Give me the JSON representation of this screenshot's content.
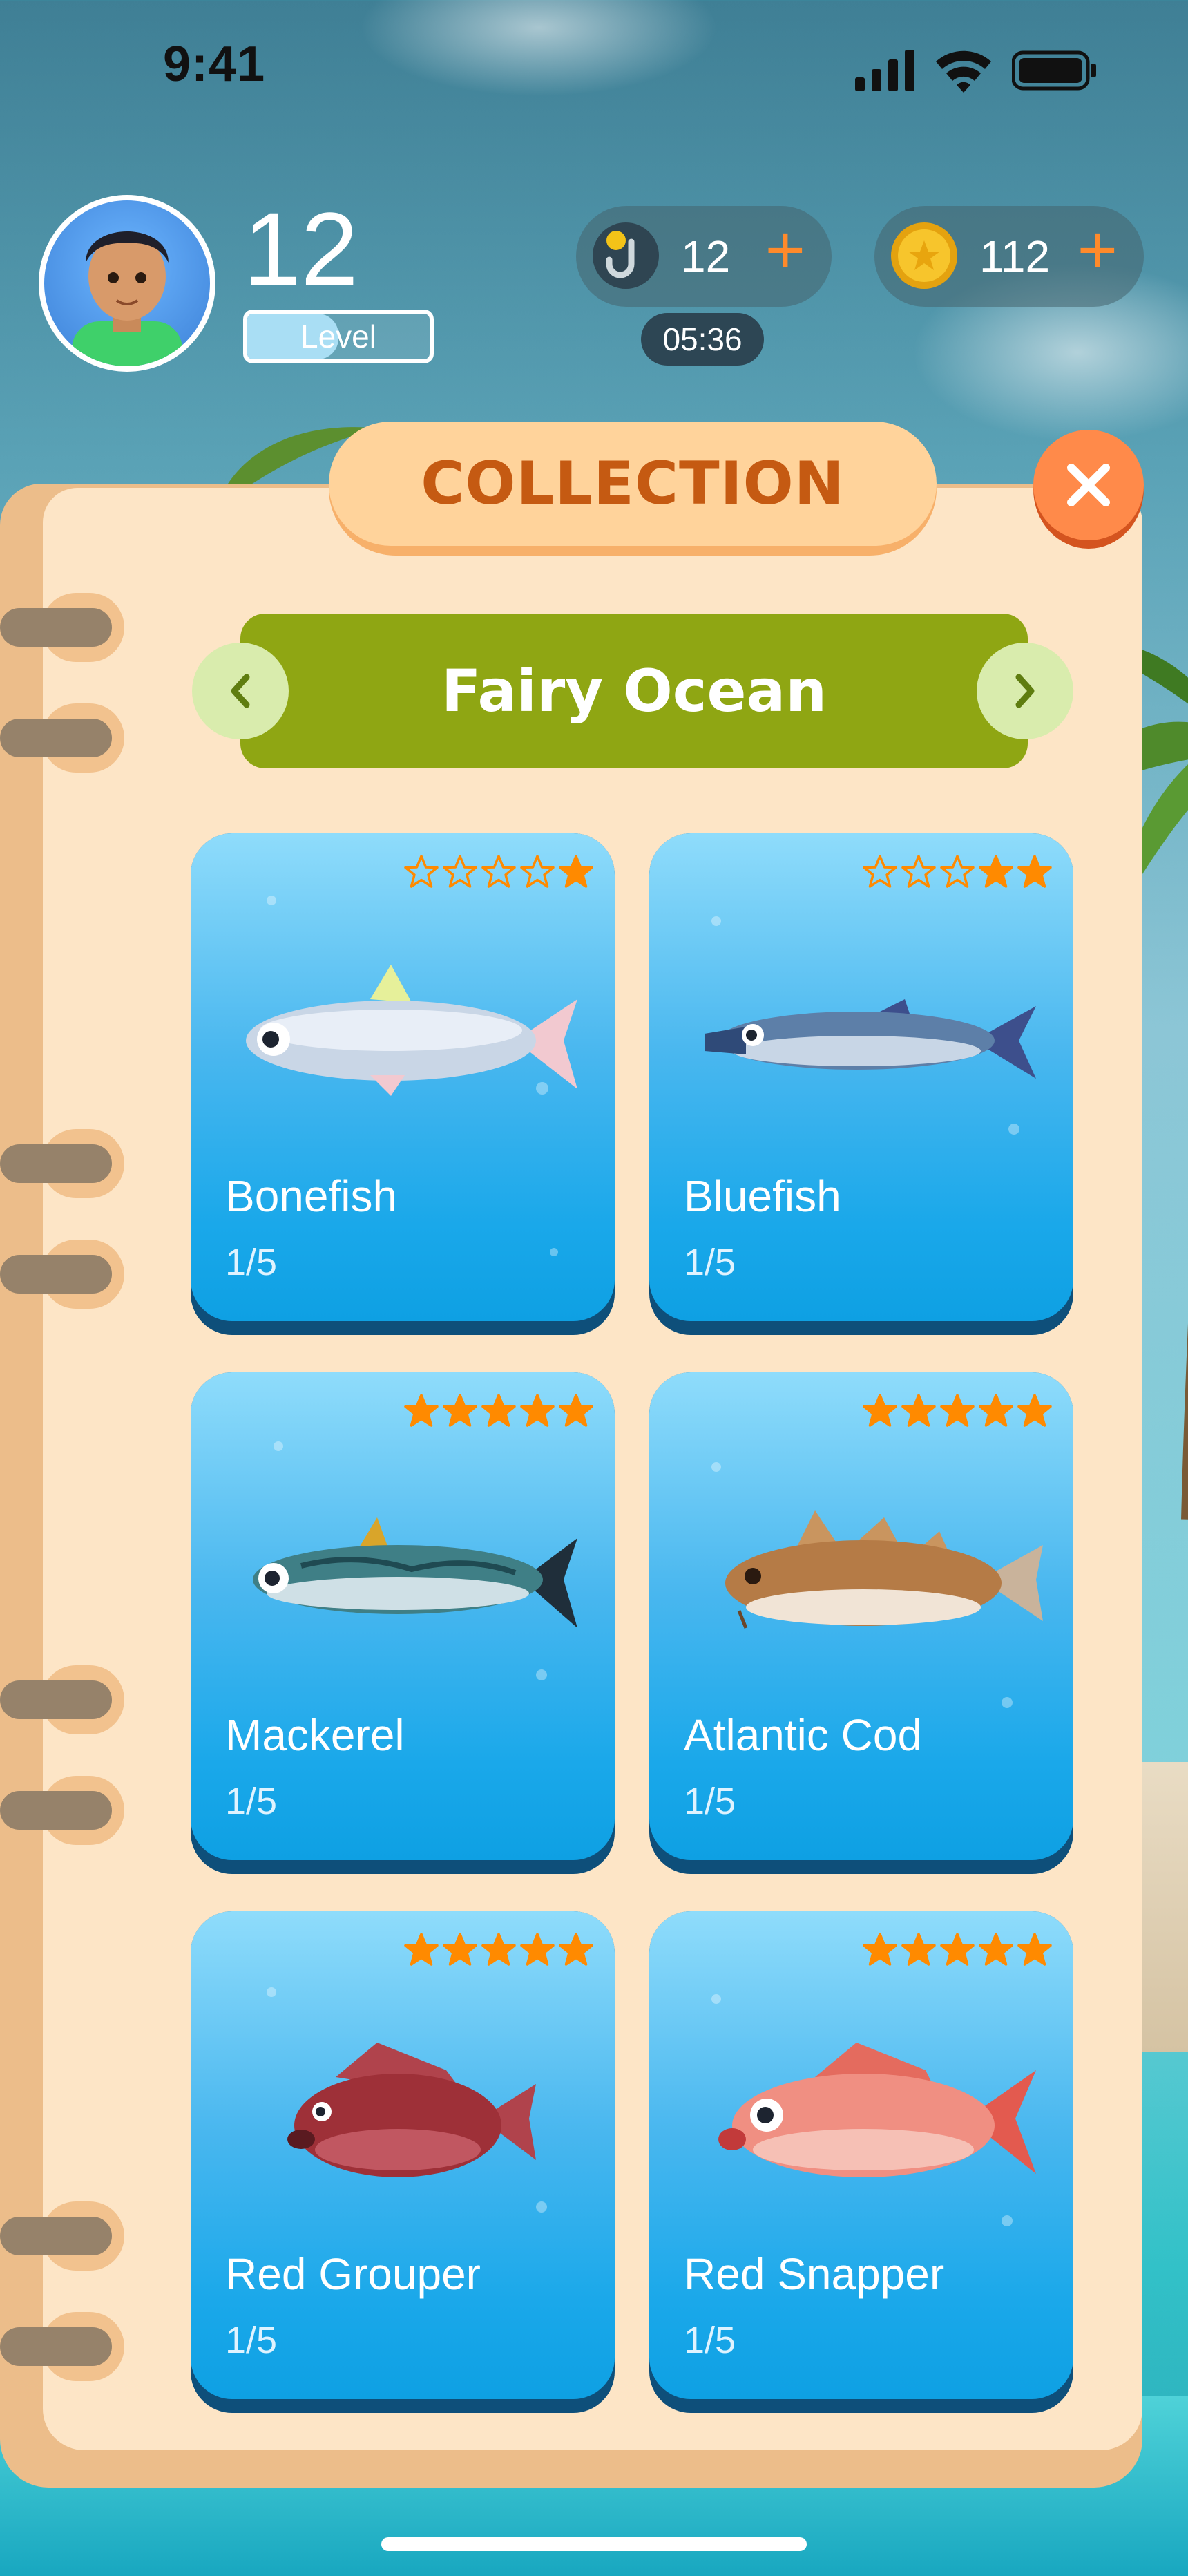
{
  "status_bar": {
    "time": "9:41"
  },
  "player": {
    "level": "12",
    "level_label": "Level",
    "level_progress": 0.5
  },
  "resources": {
    "hooks": {
      "value": "12",
      "plus": "+"
    },
    "coins": {
      "value": "112",
      "plus": "+"
    },
    "timer": "05:36"
  },
  "collection": {
    "title": "COLLECTION",
    "region": "Fairy Ocean",
    "cards": [
      {
        "name": "Bonefish",
        "count": "1/5",
        "stars_filled": 1
      },
      {
        "name": "Bluefish",
        "count": "1/5",
        "stars_filled": 2
      },
      {
        "name": "Mackerel",
        "count": "1/5",
        "stars_filled": 5
      },
      {
        "name": "Atlantic Cod",
        "count": "1/5",
        "stars_filled": 5
      },
      {
        "name": "Red Grouper",
        "count": "1/5",
        "stars_filled": 5
      },
      {
        "name": "Red Snapper",
        "count": "1/5",
        "stars_filled": 5
      }
    ]
  },
  "colors": {
    "accent_orange": "#ff8a2b",
    "title_text": "#c55a12",
    "region_bar": "#8fa613",
    "star_filled": "#ff8a00",
    "card_top": "#8fdcfb",
    "card_bottom": "#0ea0e3"
  }
}
